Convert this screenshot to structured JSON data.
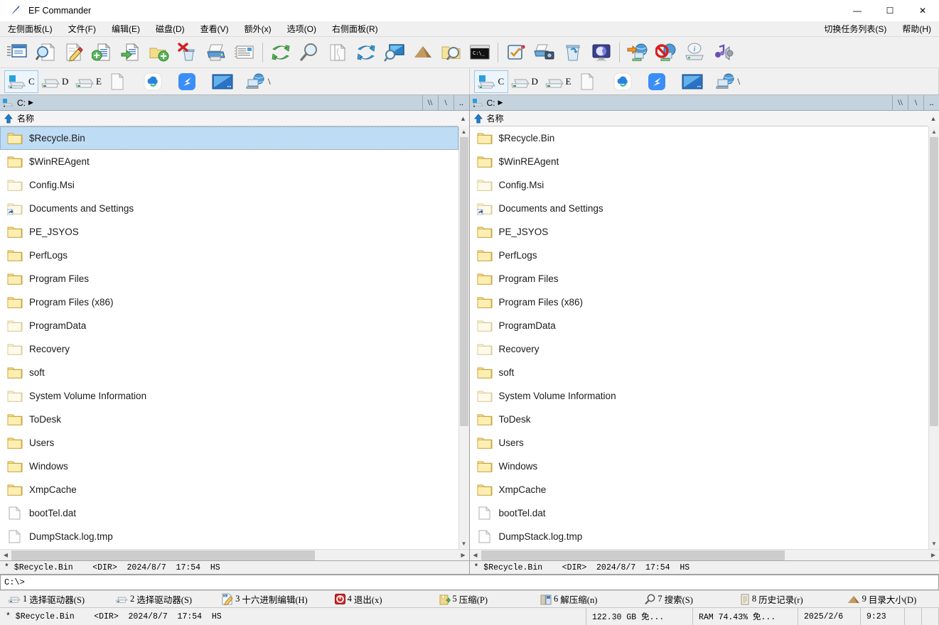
{
  "window": {
    "title": "EF Commander",
    "app_icon": "feather-pen-icon",
    "minimize_label": "—",
    "maximize_label": "☐",
    "close_label": "✕"
  },
  "menubar": {
    "left_items": [
      {
        "label": "左侧面板(L)",
        "name": "menu-left-panel"
      },
      {
        "label": "文件(F)",
        "name": "menu-file"
      },
      {
        "label": "编辑(E)",
        "name": "menu-edit"
      },
      {
        "label": "磁盘(D)",
        "name": "menu-disk"
      },
      {
        "label": "查看(V)",
        "name": "menu-view"
      },
      {
        "label": "额外(x)",
        "name": "menu-extra"
      },
      {
        "label": "选项(O)",
        "name": "menu-options"
      },
      {
        "label": "右侧面板(R)",
        "name": "menu-right-panel"
      }
    ],
    "right_items": [
      {
        "label": "切换任务列表(S)",
        "name": "menu-switch-tasklist"
      },
      {
        "label": "帮助(H)",
        "name": "menu-help"
      }
    ]
  },
  "toolbar": {
    "groups": [
      [
        {
          "icon": "window-list-icon",
          "name": "tb-open-window"
        },
        {
          "icon": "file-search-icon",
          "name": "tb-view-file"
        },
        {
          "icon": "file-edit-icon",
          "name": "tb-edit-file"
        },
        {
          "icon": "copy-file-icon",
          "name": "tb-copy"
        },
        {
          "icon": "move-file-icon",
          "name": "tb-move"
        },
        {
          "icon": "new-folder-icon",
          "name": "tb-new-folder"
        },
        {
          "icon": "delete-icon",
          "name": "tb-delete"
        },
        {
          "icon": "print-icon",
          "name": "tb-print"
        },
        {
          "icon": "properties-icon",
          "name": "tb-properties"
        }
      ],
      [
        {
          "icon": "refresh-green-icon",
          "name": "tb-refresh"
        },
        {
          "icon": "search-icon",
          "name": "tb-search"
        },
        {
          "icon": "compare-files-icon",
          "name": "tb-compare"
        },
        {
          "icon": "sync-blue-icon",
          "name": "tb-synchronize"
        },
        {
          "icon": "screen-search-icon",
          "name": "tb-find-window"
        },
        {
          "icon": "dir-size-icon",
          "name": "tb-dir-size"
        },
        {
          "icon": "folder-search-icon",
          "name": "tb-folder-search"
        },
        {
          "icon": "console-icon",
          "name": "tb-console"
        }
      ],
      [
        {
          "icon": "checklist-icon",
          "name": "tb-checklist"
        },
        {
          "icon": "scanner-icon",
          "name": "tb-scan"
        },
        {
          "icon": "recycle-bin-icon",
          "name": "tb-recycle-bin"
        },
        {
          "icon": "screensaver-icon",
          "name": "tb-screensaver"
        }
      ],
      [
        {
          "icon": "ftp-connect-icon",
          "name": "tb-ftp-connect"
        },
        {
          "icon": "ftp-disconnect-icon",
          "name": "tb-ftp-disconnect"
        },
        {
          "icon": "drive-info-icon",
          "name": "tb-drive-info"
        },
        {
          "icon": "sound-icon",
          "name": "tb-sound"
        }
      ]
    ]
  },
  "drivebar": {
    "items": [
      {
        "label": "C",
        "icon": "drive-windows-icon",
        "selected": true,
        "name": "drive-c"
      },
      {
        "label": "D",
        "icon": "drive-icon",
        "selected": false,
        "name": "drive-d"
      },
      {
        "label": "E",
        "icon": "drive-icon",
        "selected": false,
        "name": "drive-e"
      },
      {
        "label": "",
        "icon": "page-icon",
        "selected": false,
        "name": "drive-blank"
      },
      {
        "label": "",
        "icon": "cloud-disk-icon",
        "selected": false,
        "name": "drive-cloud"
      },
      {
        "label": "",
        "icon": "bird-app-icon",
        "selected": false,
        "name": "drive-bird"
      },
      {
        "label": "",
        "icon": "screen-icon",
        "selected": false,
        "name": "drive-screen"
      },
      {
        "label": "\\",
        "icon": "network-icon",
        "selected": false,
        "name": "drive-network"
      }
    ]
  },
  "panels": [
    {
      "id": "left",
      "path": "C:",
      "path_icon": "drive-small-icon",
      "jump_buttons": [
        "\\\\",
        "\\",
        ".."
      ],
      "column_header": {
        "label": "名称",
        "sort": "ascending"
      },
      "selected_index": 0,
      "scroll_thumb_pct": 72,
      "hscroll_thumb_pct": 68,
      "info": "* $Recycle.Bin    <DIR>  2024/8/7  17:54  HS",
      "files": [
        {
          "name": "$Recycle.Bin",
          "type": "folder"
        },
        {
          "name": "$WinREAgent",
          "type": "folder"
        },
        {
          "name": "Config.Msi",
          "type": "folder-hidden"
        },
        {
          "name": "Documents and Settings",
          "type": "folder-link"
        },
        {
          "name": "PE_JSYOS",
          "type": "folder"
        },
        {
          "name": "PerfLogs",
          "type": "folder"
        },
        {
          "name": "Program Files",
          "type": "folder"
        },
        {
          "name": "Program Files (x86)",
          "type": "folder"
        },
        {
          "name": "ProgramData",
          "type": "folder-hidden"
        },
        {
          "name": "Recovery",
          "type": "folder-hidden"
        },
        {
          "name": "soft",
          "type": "folder"
        },
        {
          "name": "System Volume Information",
          "type": "folder-hidden"
        },
        {
          "name": "ToDesk",
          "type": "folder"
        },
        {
          "name": "Users",
          "type": "folder"
        },
        {
          "name": "Windows",
          "type": "folder"
        },
        {
          "name": "XmpCache",
          "type": "folder"
        },
        {
          "name": "bootTel.dat",
          "type": "file"
        },
        {
          "name": "DumpStack.log.tmp",
          "type": "file"
        }
      ]
    },
    {
      "id": "right",
      "path": "C:",
      "path_icon": "drive-small-icon",
      "jump_buttons": [
        "\\\\",
        "\\",
        ".."
      ],
      "column_header": {
        "label": "名称",
        "sort": "ascending"
      },
      "selected_index": -1,
      "scroll_thumb_pct": 72,
      "hscroll_thumb_pct": 68,
      "info": "* $Recycle.Bin    <DIR>  2024/8/7  17:54  HS",
      "files": [
        {
          "name": "$Recycle.Bin",
          "type": "folder"
        },
        {
          "name": "$WinREAgent",
          "type": "folder"
        },
        {
          "name": "Config.Msi",
          "type": "folder-hidden"
        },
        {
          "name": "Documents and Settings",
          "type": "folder-link"
        },
        {
          "name": "PE_JSYOS",
          "type": "folder"
        },
        {
          "name": "PerfLogs",
          "type": "folder"
        },
        {
          "name": "Program Files",
          "type": "folder"
        },
        {
          "name": "Program Files (x86)",
          "type": "folder"
        },
        {
          "name": "ProgramData",
          "type": "folder-hidden"
        },
        {
          "name": "Recovery",
          "type": "folder-hidden"
        },
        {
          "name": "soft",
          "type": "folder"
        },
        {
          "name": "System Volume Information",
          "type": "folder-hidden"
        },
        {
          "name": "ToDesk",
          "type": "folder"
        },
        {
          "name": "Users",
          "type": "folder"
        },
        {
          "name": "Windows",
          "type": "folder"
        },
        {
          "name": "XmpCache",
          "type": "folder"
        },
        {
          "name": "bootTel.dat",
          "type": "file"
        },
        {
          "name": "DumpStack.log.tmp",
          "type": "file"
        }
      ]
    }
  ],
  "commandline": {
    "value": "C:\\>",
    "placeholder": ""
  },
  "fkeys": [
    {
      "num": "1",
      "label": "选择驱动器(S)",
      "icon": "drive-icon",
      "name": "fkey-f1"
    },
    {
      "num": "2",
      "label": "选择驱动器(S)",
      "icon": "drive-icon",
      "name": "fkey-f2"
    },
    {
      "num": "3",
      "label": "十六进制编辑(H)",
      "icon": "hex-edit-icon",
      "name": "fkey-f3"
    },
    {
      "num": "4",
      "label": "退出(x)",
      "icon": "exit-icon",
      "name": "fkey-f4"
    },
    {
      "num": "5",
      "label": "压缩(P)",
      "icon": "compress-icon",
      "name": "fkey-f5"
    },
    {
      "num": "6",
      "label": "解压缩(n)",
      "icon": "extract-icon",
      "name": "fkey-f6"
    },
    {
      "num": "7",
      "label": "搜索(S)",
      "icon": "search-icon",
      "name": "fkey-f7"
    },
    {
      "num": "8",
      "label": "历史记录(r)",
      "icon": "history-icon",
      "name": "fkey-f8"
    },
    {
      "num": "9",
      "label": "目录大小(D)",
      "icon": "dir-size-icon",
      "name": "fkey-f9"
    }
  ],
  "statusbar": {
    "file_info": "* $Recycle.Bin    <DIR>  2024/8/7  17:54  HS",
    "disk_free": "122.30 GB 免...",
    "ram": "RAM 74.43% 免...",
    "date": "2025/2/6",
    "time": "9:23"
  }
}
